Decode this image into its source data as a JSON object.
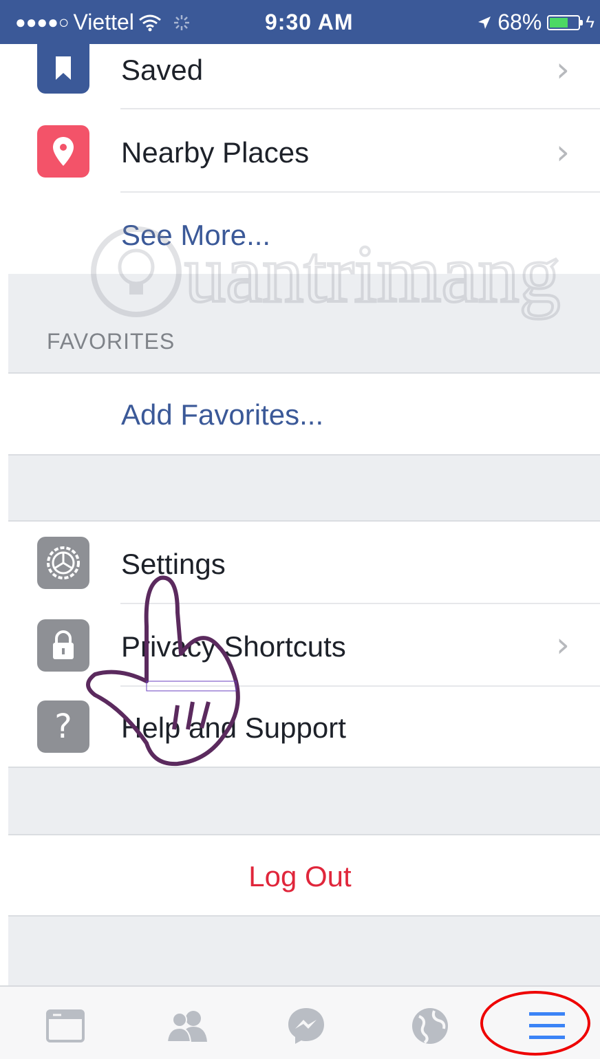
{
  "status_bar": {
    "signal_dots": "●●●●○",
    "carrier": "Viettel",
    "time": "9:30 AM",
    "battery": "68%",
    "battery_level": 0.68
  },
  "menu": {
    "saved": {
      "label": "Saved",
      "icon": "bookmark-icon",
      "color": "#3b5998"
    },
    "nearby": {
      "label": "Nearby Places",
      "icon": "location-pin-icon",
      "color": "#f35369"
    },
    "see_more": "See More..."
  },
  "favorites": {
    "header": "FAVORITES",
    "add": "Add Favorites..."
  },
  "settings_section": {
    "settings": {
      "label": "Settings",
      "icon": "gear-icon"
    },
    "privacy": {
      "label": "Privacy Shortcuts",
      "icon": "lock-icon"
    },
    "help": {
      "label": "Help and Support",
      "icon": "question-icon"
    }
  },
  "logout": "Log Out",
  "tab_bar": {
    "tabs": [
      "news-feed-icon",
      "friends-icon",
      "messenger-icon",
      "globe-icon",
      "menu-icon"
    ],
    "active_color": "#3b83f6"
  },
  "watermark_text": "uantrimang"
}
